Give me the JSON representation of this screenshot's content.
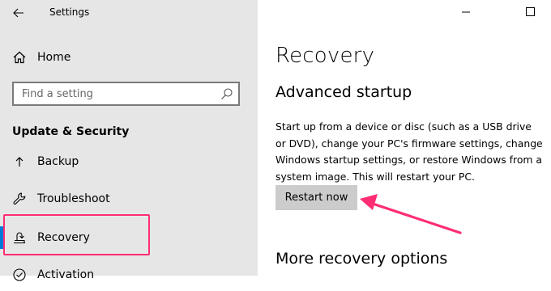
{
  "window": {
    "title": "Settings"
  },
  "sidebar": {
    "home_label": "Home",
    "search": {
      "placeholder": "Find a setting"
    },
    "section_title": "Update & Security",
    "items": [
      {
        "label": "Backup",
        "icon": "backup-icon"
      },
      {
        "label": "Troubleshoot",
        "icon": "wrench-icon"
      },
      {
        "label": "Recovery",
        "icon": "recovery-icon",
        "selected": true
      },
      {
        "label": "Activation",
        "icon": "check-circle-icon"
      }
    ]
  },
  "main": {
    "page_title": "Recovery",
    "advanced_startup": {
      "heading": "Advanced startup",
      "description": "Start up from a device or disc (such as a USB drive or DVD), change your PC's firmware settings, change Windows startup settings, or restore Windows from a system image. This will restart your PC.",
      "button_label": "Restart now"
    },
    "more_options_heading": "More recovery options"
  },
  "colors": {
    "sidebar_bg": "#e6e6e6",
    "accent": "#0078d7",
    "annotation": "#ff2d74",
    "button_bg": "#cccccc"
  }
}
